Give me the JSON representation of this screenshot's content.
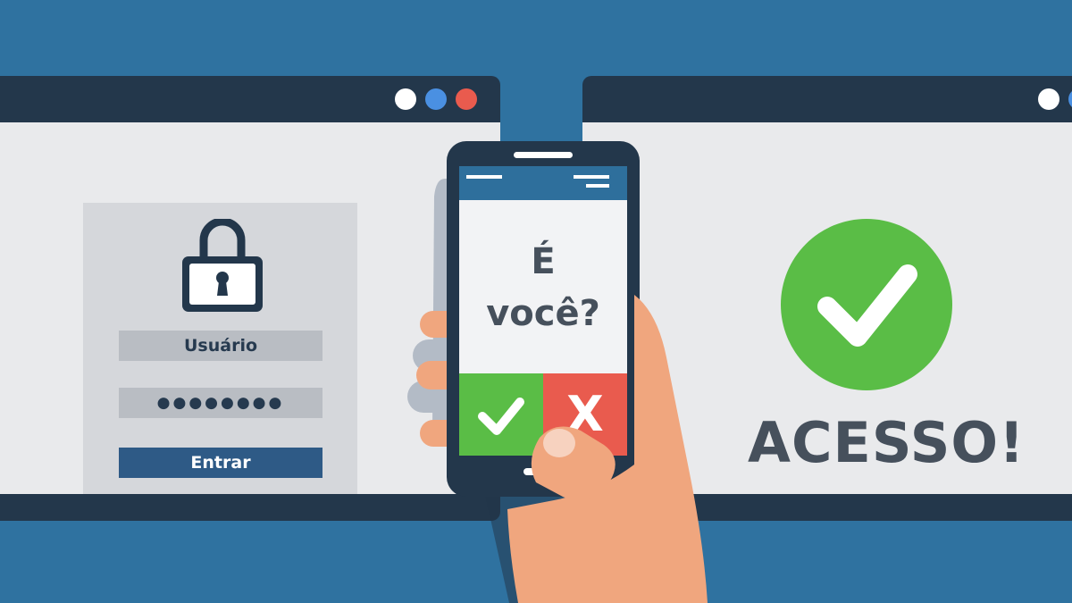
{
  "colors": {
    "background": "#2f72a0",
    "window_frame": "#23374b",
    "window_content": "#e9eaec",
    "success_green": "#5abd46",
    "deny_red": "#e95b4e",
    "primary_button": "#2e5a86"
  },
  "login_window": {
    "lock_icon": "padlock-icon",
    "username_label": "Usuário",
    "password_mask": "●●●●●●●●",
    "submit_label": "Entrar"
  },
  "phone": {
    "question_line1": "É",
    "question_line2": "você?",
    "approve_icon": "check-icon",
    "deny_label": "X"
  },
  "result_window": {
    "success_icon": "check-circle-icon",
    "message": "ACESSO!"
  }
}
